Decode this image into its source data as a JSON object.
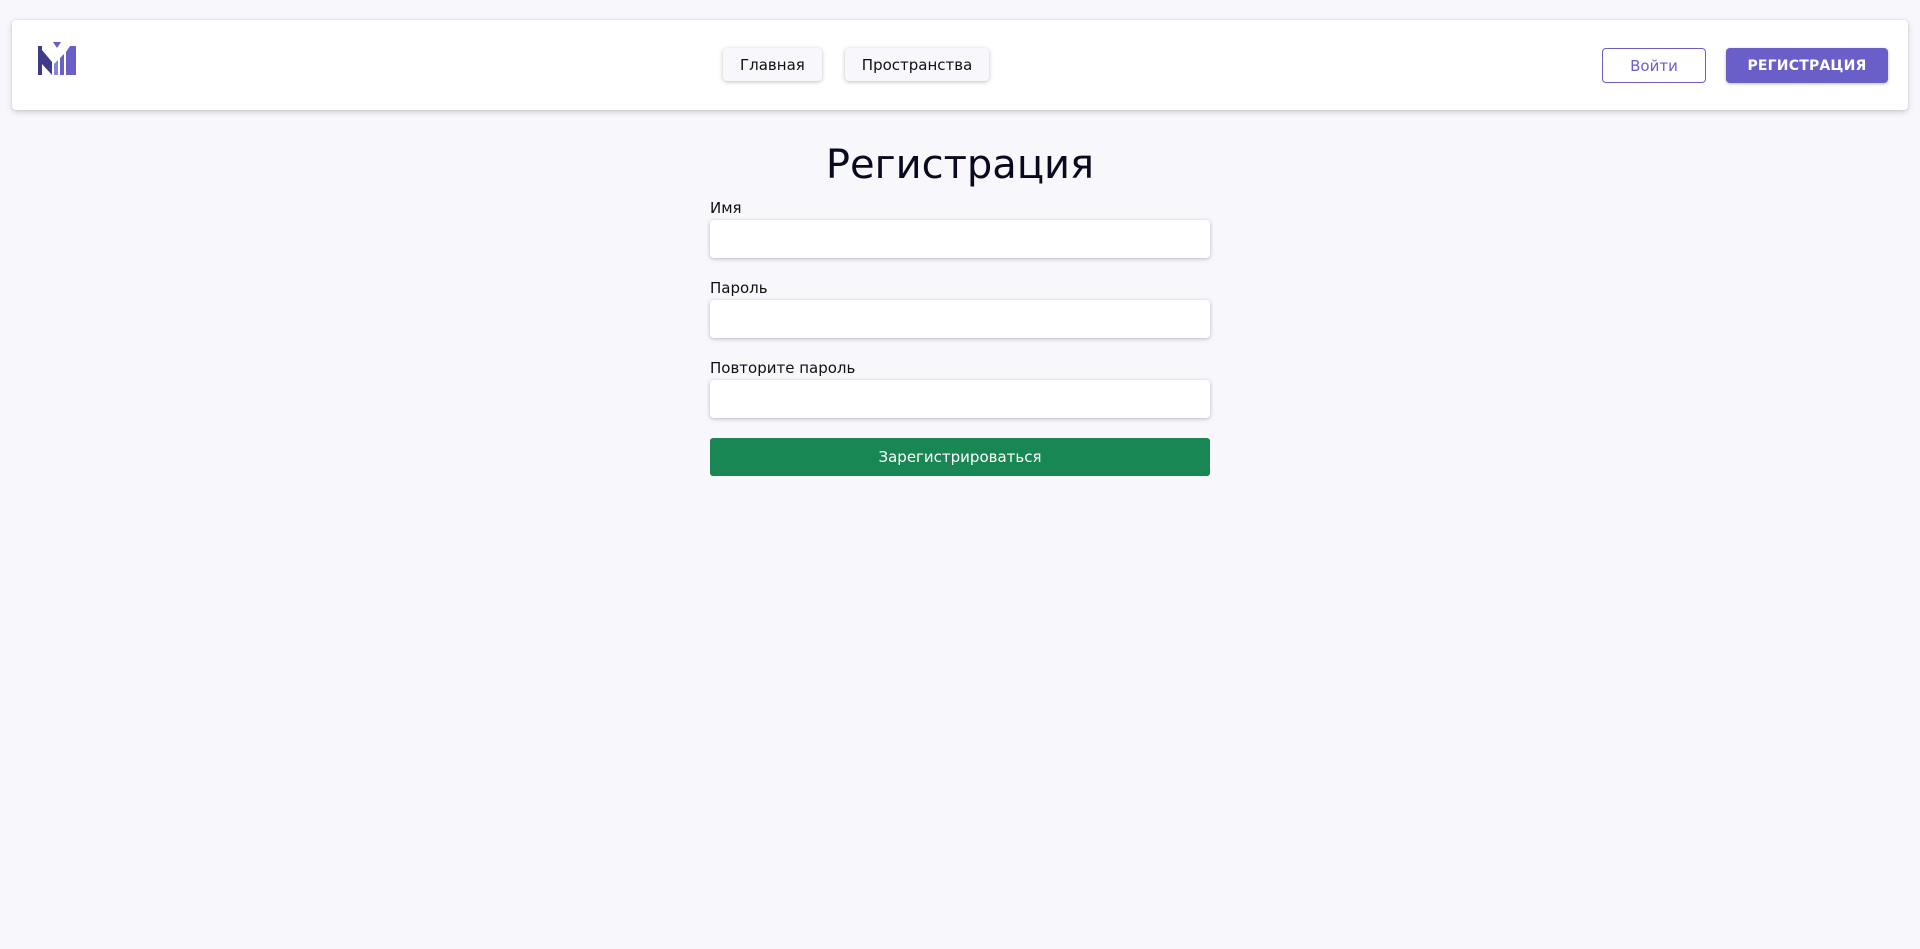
{
  "colors": {
    "accent": "#6a5fc9",
    "submit": "#198754",
    "background": "#f7f7fc"
  },
  "header": {
    "logo_icon": "bar-chart-logo-icon",
    "nav": {
      "home_label": "Главная",
      "spaces_label": "Пространства"
    },
    "login_label": "Войти",
    "register_label": "РЕГИСТРАЦИЯ"
  },
  "page": {
    "title": "Регистрация"
  },
  "form": {
    "name_label": "Имя",
    "name_value": "",
    "password_label": "Пароль",
    "password_value": "",
    "repeat_password_label": "Повторите пароль",
    "repeat_password_value": "",
    "submit_label": "Зарегистрироваться"
  }
}
